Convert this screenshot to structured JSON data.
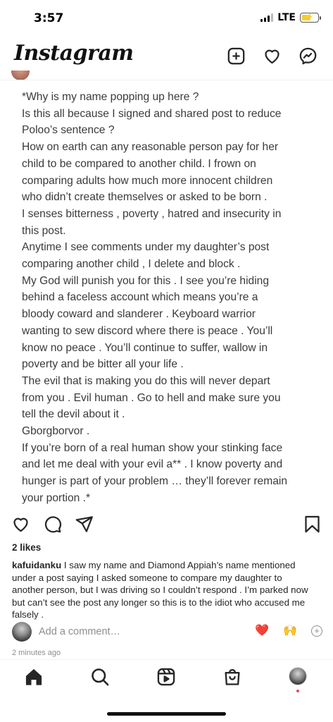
{
  "status_bar": {
    "time": "3:57",
    "network": "LTE",
    "battery_level": 0.55,
    "battery_color": "#f7cd2e"
  },
  "header": {
    "logo": "Instagram",
    "icons": [
      "new-post-icon",
      "heart-icon",
      "messenger-icon"
    ]
  },
  "post": {
    "image_text": "*Why is my name popping up here ?\nIs this all because I signed and shared post to reduce\nPoloo’s sentence ?\nHow on earth can any reasonable person pay for her\nchild to be compared to another child. I frown on\ncomparing adults how much more innocent children\nwho didn’t create themselves or asked to be born .\nI senses bitterness , poverty , hatred  and insecurity in\nthis post.\nAnytime I see comments under my daughter’s post\ncomparing another child , I delete and block .\nMy God will punish you for this . I see you’re hiding\nbehind a faceless account which means you’re a\nbloody coward  and slanderer . Keyboard warrior\nwanting to sew discord where there is peace . You’ll\nknow no peace . You’ll continue to suffer, wallow in\npoverty and be bitter all your life .\nThe evil that is making you do this will never depart\nfrom you . Evil human . Go to hell and make sure you\ntell the devil about it .\nGborgborvor .\nIf you’re born of a real human show your stinking face\nand let me deal with your evil a** . I know poverty and\nhunger is part of your problem … they’ll forever remain\nyour portion .*",
    "likes": "2 likes",
    "caption_user": "kafuidanku",
    "caption_text": " I saw my name and Diamond Appiah’s name mentioned under a post saying I asked someone to compare my daughter to another person, but I was driving so I couldn’t respond . I’m parked now but can’t see the post any longer so this is to the idiot who accused me falsely .",
    "comment_placeholder": "Add a comment…",
    "comment_emojis": [
      "❤️",
      "🙌"
    ],
    "timestamp": "2 minutes ago"
  },
  "bottom_nav": {
    "items": [
      "home-icon",
      "search-icon",
      "reels-icon",
      "shop-icon",
      "profile-avatar"
    ],
    "notification_color": "#ed4956"
  }
}
